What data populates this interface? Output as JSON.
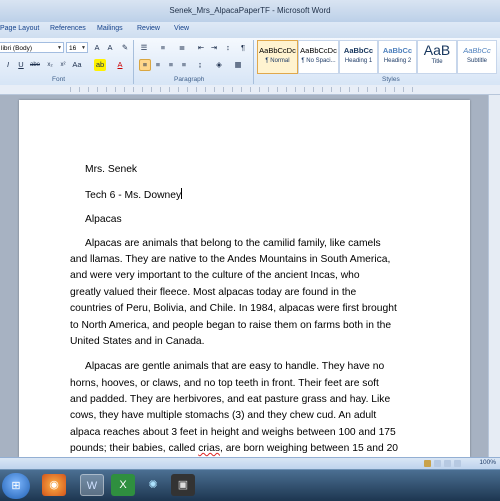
{
  "window": {
    "title": "Senek_Mrs_AlpacaPaperTF - Microsoft Word"
  },
  "ribbon_tabs": [
    "Page Layout",
    "References",
    "Mailings",
    "Review",
    "View"
  ],
  "font": {
    "name": "libri (Body)",
    "size": "16"
  },
  "groups": {
    "font": "Font",
    "paragraph": "Paragraph",
    "styles": "Styles"
  },
  "styles_gallery": [
    {
      "sample": "AaBbCcDc",
      "name": "¶ Normal"
    },
    {
      "sample": "AaBbCcDc",
      "name": "¶ No Spaci..."
    },
    {
      "sample": "AaBbCc",
      "name": "Heading 1"
    },
    {
      "sample": "AaBbCc",
      "name": "Heading 2"
    },
    {
      "sample": "AaB",
      "name": "Title"
    },
    {
      "sample": "AaBbCc",
      "name": "Subtitle"
    }
  ],
  "document": {
    "header_lines": [
      "Mrs. Senek",
      "Tech 6 - Ms. Downey",
      "Alpacas"
    ],
    "paragraph1": [
      "Alpacas are animals that belong to the camilid family, like camels",
      "and llamas. They are native to the Andes Mountains in South America,",
      "and were very important to the culture of the ancient Incas, who",
      "greatly valued their fleece. Most alpacas today are found in the",
      "countries of Peru, Bolivia, and Chile. In 1984, alpacas were first brought",
      "to North America, and people began to raise them on farms both in the",
      "United States and in Canada."
    ],
    "paragraph2": [
      "Alpacas are gentle animals that are easy to handle. They have no",
      "horns, hooves, or claws, and no top teeth in front. Their feet are soft",
      "and padded. They are herbivores, and eat pasture grass and hay. Like",
      "cows, they have multiple stomachs (3) and they chew cud. An adult",
      "alpaca reaches about 3 feet in height and weighs between 100 and 175"
    ],
    "last_line": {
      "before": "pounds; their babies, called ",
      "misspelled": "crias",
      "after": ", are born weighing between 15 and 20"
    }
  },
  "status": {
    "zoom": "100%"
  },
  "taskbar_icons": [
    "start-orb-icon",
    "firefox-icon",
    "word-icon",
    "excel-icon",
    "app-icon",
    "film-icon"
  ],
  "colors": {
    "ribbon_accent": "#15428b",
    "selected_style": "#ffd68a"
  }
}
